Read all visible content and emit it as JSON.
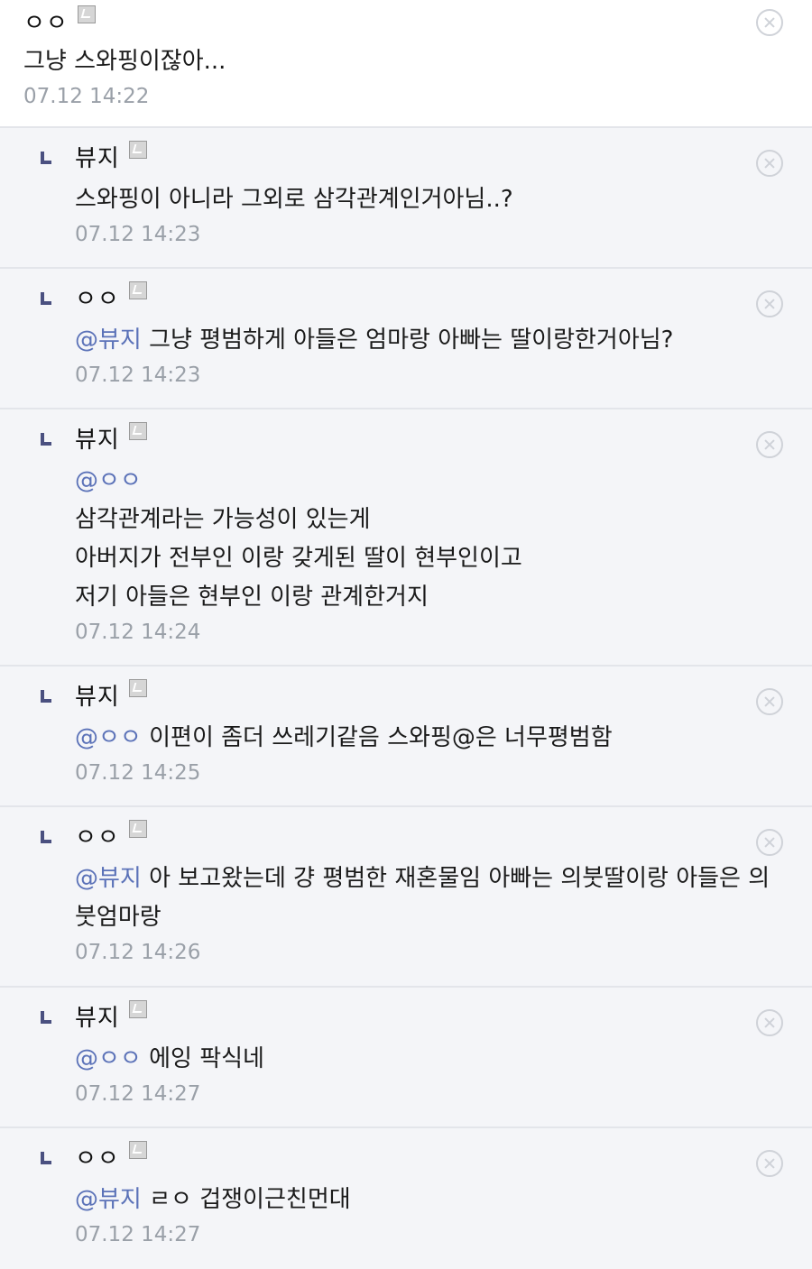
{
  "comments": [
    {
      "nick": "ㅇㅇ",
      "mention": "",
      "lines": [
        "그냥 스와핑이잖아..."
      ],
      "time": "07.12 14:22"
    },
    {
      "nick": "뷰지",
      "mention": "",
      "lines": [
        "스와핑이 아니라 그외로 삼각관계인거아님..?"
      ],
      "time": "07.12 14:23"
    },
    {
      "nick": "ㅇㅇ",
      "mention": "@뷰지",
      "lines": [
        "그냥 평범하게 아들은 엄마랑 아빠는 딸이랑한거아님?"
      ],
      "time": "07.12 14:23"
    },
    {
      "nick": "뷰지",
      "mention": "@ㅇㅇ",
      "lines": [
        "삼각관계라는 가능성이 있는게",
        "아버지가 전부인 이랑 갖게된 딸이 현부인이고",
        "저기 아들은 현부인 이랑 관계한거지"
      ],
      "time": "07.12 14:24"
    },
    {
      "nick": "뷰지",
      "mention": "@ㅇㅇ",
      "lines": [
        "이편이 좀더 쓰레기같음 스와핑@은 너무평범함"
      ],
      "time": "07.12 14:25"
    },
    {
      "nick": "ㅇㅇ",
      "mention": "@뷰지",
      "lines": [
        "아 보고왔는데 걍 평범한 재혼물임 아빠는 의붓딸이랑 아들은 의붓엄마랑"
      ],
      "time": "07.12 14:26"
    },
    {
      "nick": "뷰지",
      "mention": "@ㅇㅇ",
      "lines": [
        "에잉 팍식네"
      ],
      "time": "07.12 14:27"
    },
    {
      "nick": "ㅇㅇ",
      "mention": "@뷰지",
      "lines": [
        "ㄹㅇ 겁쟁이근친먼대"
      ],
      "time": "07.12 14:27"
    }
  ]
}
